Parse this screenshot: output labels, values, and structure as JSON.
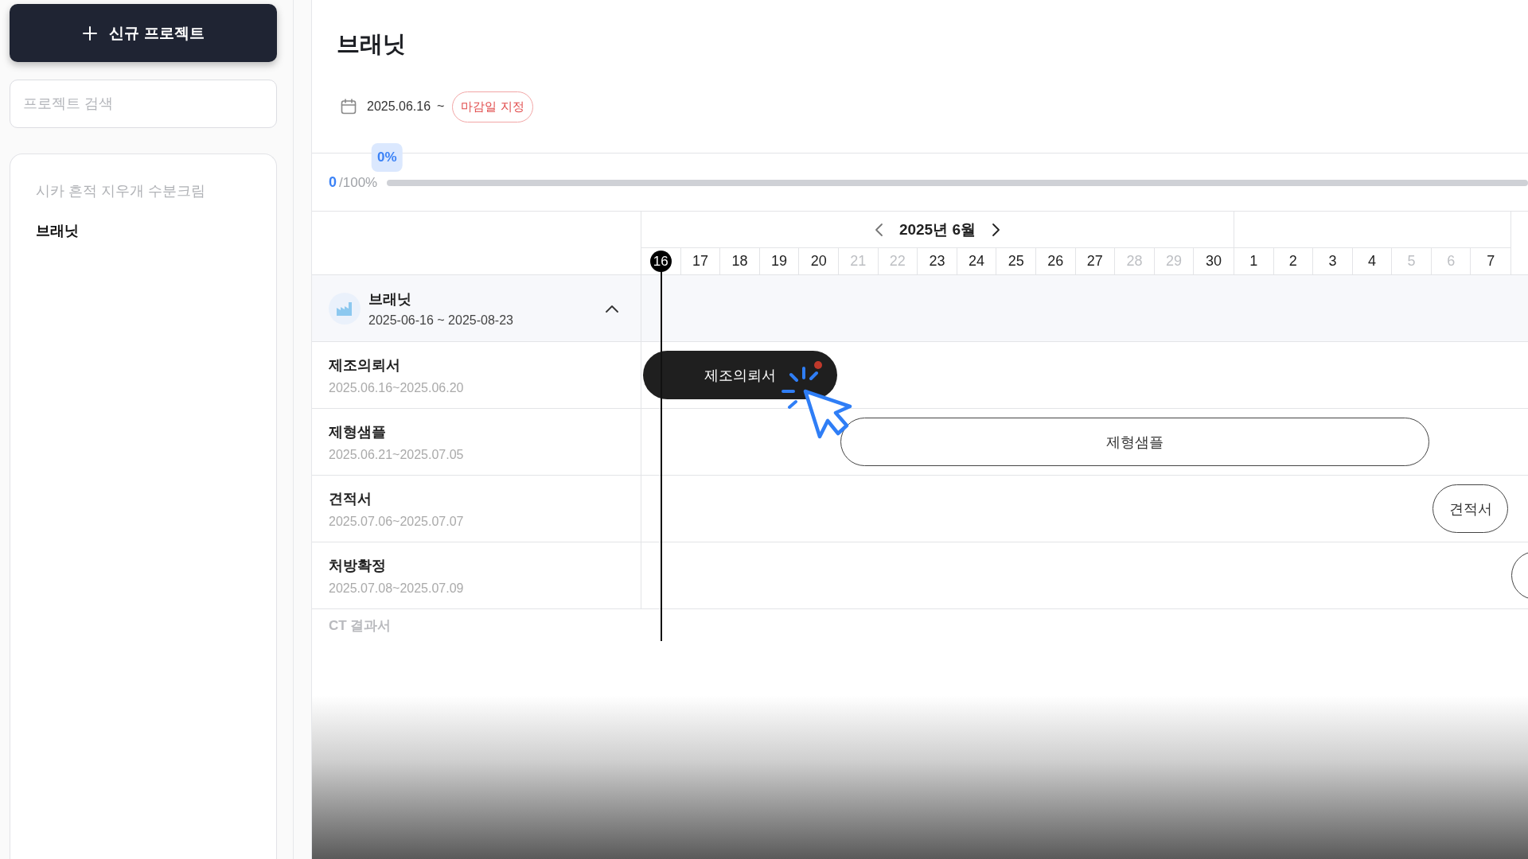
{
  "sidebar": {
    "new_button": "신규 프로젝트",
    "search": {
      "placeholder": "프로젝트 검색"
    },
    "projects": [
      {
        "name": "시카 흔적 지우개 수분크림",
        "selected": false
      },
      {
        "name": "브래닛",
        "selected": true
      }
    ]
  },
  "project": {
    "title": "브래닛",
    "start_date": "2025.06.16",
    "range_sep": "~",
    "deadline_button": "마감일 지정"
  },
  "progress": {
    "badge": "0%",
    "done": "0",
    "total": "/100%",
    "level": 0
  },
  "timeline": {
    "months": [
      {
        "label": "2025년 6월",
        "nav": true,
        "days": [
          {
            "label": "16",
            "today": true,
            "weekend": false
          },
          {
            "label": "17",
            "today": false,
            "weekend": false
          },
          {
            "label": "18",
            "today": false,
            "weekend": false
          },
          {
            "label": "19",
            "today": false,
            "weekend": false
          },
          {
            "label": "20",
            "today": false,
            "weekend": false
          },
          {
            "label": "21",
            "today": false,
            "weekend": true
          },
          {
            "label": "22",
            "today": false,
            "weekend": true
          },
          {
            "label": "23",
            "today": false,
            "weekend": false
          },
          {
            "label": "24",
            "today": false,
            "weekend": false
          },
          {
            "label": "25",
            "today": false,
            "weekend": false
          },
          {
            "label": "26",
            "today": false,
            "weekend": false
          },
          {
            "label": "27",
            "today": false,
            "weekend": false
          },
          {
            "label": "28",
            "today": false,
            "weekend": true
          },
          {
            "label": "29",
            "today": false,
            "weekend": true
          },
          {
            "label": "30",
            "today": false,
            "weekend": false
          }
        ]
      },
      {
        "nav": false,
        "days": [
          {
            "label": "1",
            "today": false,
            "weekend": false
          },
          {
            "label": "2",
            "today": false,
            "weekend": false
          },
          {
            "label": "3",
            "today": false,
            "weekend": false
          },
          {
            "label": "4",
            "today": false,
            "weekend": false
          },
          {
            "label": "5",
            "today": false,
            "weekend": true
          },
          {
            "label": "6",
            "today": false,
            "weekend": true
          },
          {
            "label": "7",
            "today": false,
            "weekend": false
          }
        ]
      }
    ]
  },
  "group": {
    "name": "브래닛",
    "dates": "2025-06-16 ~ 2025-08-23",
    "expanded": true
  },
  "tasks": [
    {
      "name": "제조의뢰서",
      "dates": "2025.06.16~2025.06.20",
      "bar": {
        "kind": "filled",
        "label": "제조의뢰서",
        "alert": true
      }
    },
    {
      "name": "제형샘플",
      "dates": "2025.06.21~2025.07.05",
      "bar": {
        "kind": "outline",
        "label": "제형샘플",
        "alert": false
      }
    },
    {
      "name": "견적서",
      "dates": "2025.07.06~2025.07.07",
      "bar": {
        "kind": "outline",
        "label": "견적서",
        "alert": false
      }
    },
    {
      "name": "처방확정",
      "dates": "2025.07.08~2025.07.09",
      "bar": {
        "kind": "outline"
      }
    }
  ],
  "faded_task": {
    "name": "CT 결과서"
  }
}
